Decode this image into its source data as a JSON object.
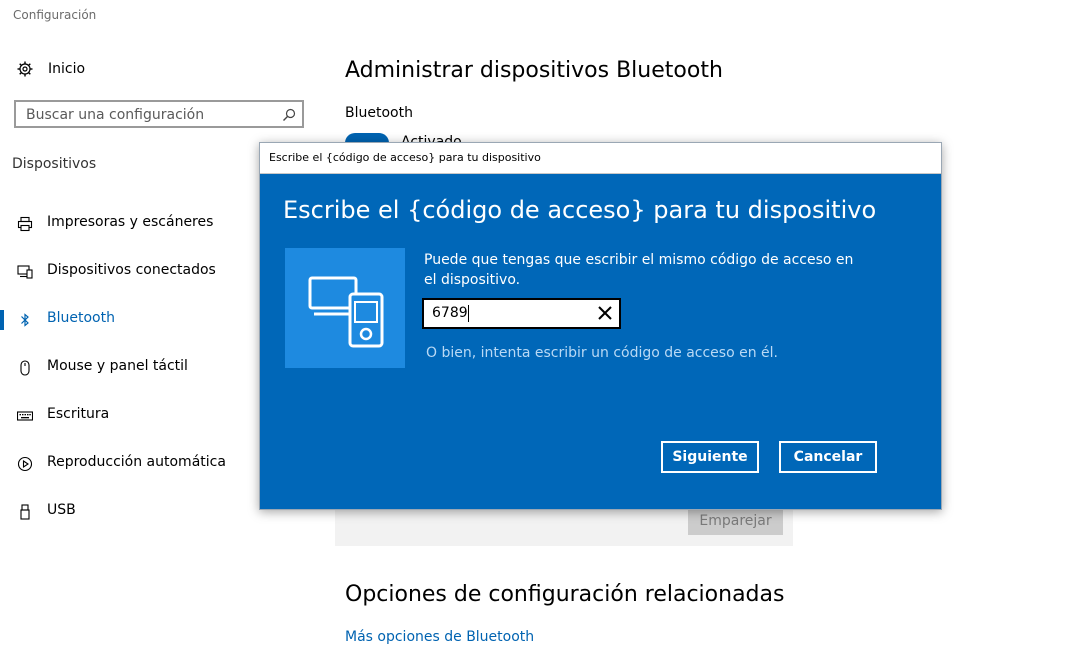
{
  "window": {
    "title": "Configuración"
  },
  "sidebar": {
    "home": {
      "label": "Inicio",
      "icon": "gear-icon"
    },
    "search": {
      "placeholder": "Buscar una configuración",
      "icon": "search-icon"
    },
    "section_label": "Dispositivos",
    "items": [
      {
        "label": "Impresoras y escáneres",
        "icon": "printer-icon"
      },
      {
        "label": "Dispositivos conectados",
        "icon": "connected-devices-icon"
      },
      {
        "label": "Bluetooth",
        "icon": "bluetooth-icon",
        "active": true
      },
      {
        "label": "Mouse y panel táctil",
        "icon": "mouse-icon"
      },
      {
        "label": "Escritura",
        "icon": "keyboard-icon"
      },
      {
        "label": "Reproducción automática",
        "icon": "autoplay-icon"
      },
      {
        "label": "USB",
        "icon": "usb-icon"
      }
    ]
  },
  "main": {
    "title": "Administrar dispositivos Bluetooth",
    "bluetooth_label": "Bluetooth",
    "toggle_text": "Activado",
    "pair_button": "Emparejar",
    "related_title": "Opciones de configuración relacionadas",
    "more_link": "Más opciones de Bluetooth"
  },
  "dialog": {
    "window_title": "Escribe el {código de acceso} para tu dispositivo",
    "heading": "Escribe el {código de acceso} para tu dispositivo",
    "message": "Puede que tengas que escribir el mismo código de acceso en el dispositivo.",
    "pin_value": "6789",
    "alt_text": "O bien, intenta escribir un código de acceso en él.",
    "next_button": "Siguiente",
    "cancel_button": "Cancelar",
    "icon": "devices-icon"
  },
  "colors": {
    "accent": "#0063b1",
    "dialog_bg": "#0067b8",
    "dialog_icon_bg": "#1e8ae0",
    "dialog_alt_text": "#b9d9f5"
  }
}
